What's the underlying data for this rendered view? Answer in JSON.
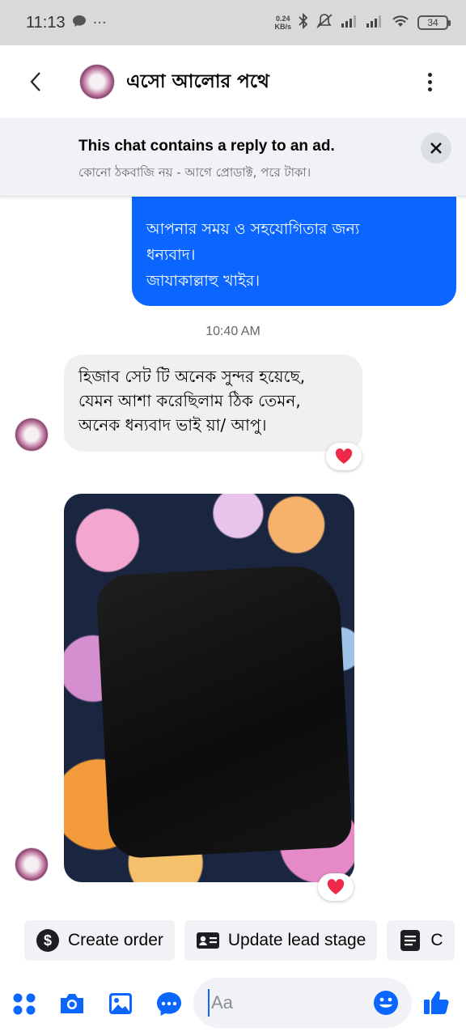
{
  "status_bar": {
    "time": "11:13",
    "dots": "···",
    "net_speed_value": "0.24",
    "net_speed_unit": "KB/s",
    "battery": "34"
  },
  "header": {
    "title": "এসো আলোর পথে"
  },
  "ad_banner": {
    "title": "This chat contains a reply to an ad.",
    "subtitle": "কোনো ঠকবাজি নয় - আগে প্রোডাক্ট, পরে টাকা।"
  },
  "messages": {
    "outgoing": {
      "lines": [
        "আপনার সময় ও সহযোগিতার জন্য",
        "ধন্যবাদ।",
        "জাযাকাল্লাহু খাইর।"
      ]
    },
    "timestamp": "10:40 AM",
    "incoming": {
      "lines": [
        "হিজাব সেট টি অনেক সুন্দর হয়েছে,",
        "যেমন আশা করেছিলাম ঠিক তেমন,",
        "অনেক ধন্যবাদ ভাই য়া/ আপু।"
      ],
      "reaction": "heart"
    },
    "photo": {
      "reaction": "heart"
    }
  },
  "quick_actions": [
    {
      "label": "Create order",
      "icon": "dollar-icon"
    },
    {
      "label": "Update lead stage",
      "icon": "contact-card-icon"
    },
    {
      "label": "C",
      "icon": "notes-icon"
    }
  ],
  "composer": {
    "placeholder": "Aa"
  },
  "colors": {
    "accent": "#0a66ff",
    "bubble_in": "#f0f0f0",
    "heart": "#f02849"
  }
}
